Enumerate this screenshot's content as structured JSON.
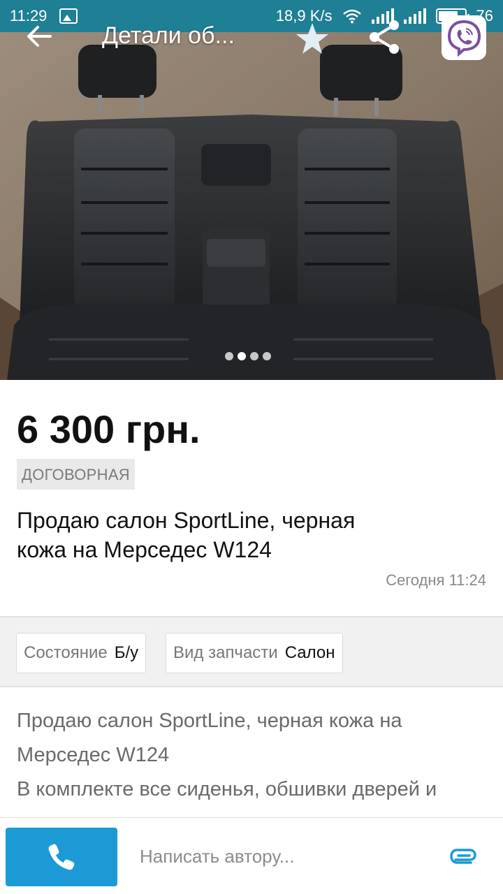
{
  "status_bar": {
    "time": "11:29",
    "network_speed": "18,9 K/s",
    "battery": "76",
    "battery_level": 0.76
  },
  "toolbar": {
    "title": "Детали об...",
    "back_icon": "arrow-left-icon",
    "star_icon": "star-icon",
    "share_icon": "share-icon",
    "viber_icon": "viber-icon"
  },
  "gallery": {
    "image_count": 4,
    "active_index": 1
  },
  "listing": {
    "price": "6 300 грн.",
    "negotiable": "ДОГОВОРНАЯ",
    "title": "Продаю салон SportLine, черная кожа на Мерседес W124",
    "date": "Сегодня 11:24"
  },
  "attributes": [
    {
      "key": "Состояние",
      "value": "Б/у"
    },
    {
      "key": "Вид запчасти",
      "value": "Салон"
    }
  ],
  "description": {
    "line1": "Продаю салон SportLine, черная кожа на",
    "line2": "Мерседес W124",
    "line3": "В комплекте все сиденья, обшивки дверей и"
  },
  "bottom_bar": {
    "message_placeholder": "Написать автору...",
    "call_icon": "phone-icon",
    "attach_icon": "paperclip-icon"
  },
  "colors": {
    "status_bar": "#1f7f94",
    "accent": "#1c9ad6",
    "viber": "#7b519d"
  }
}
